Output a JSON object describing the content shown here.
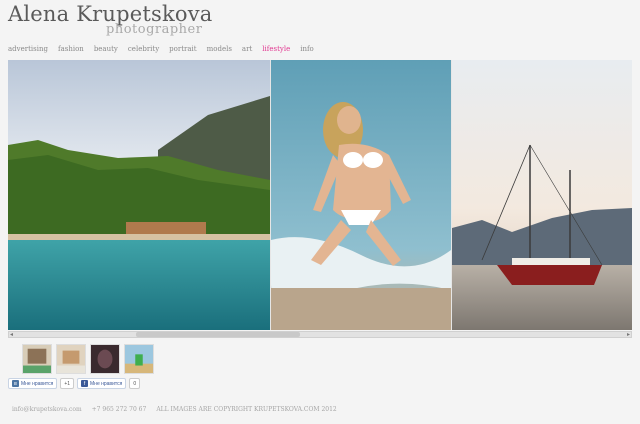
{
  "header": {
    "name": "Alena Krupetskova",
    "tagline": "photographer"
  },
  "nav": {
    "items": [
      {
        "label": "advertising"
      },
      {
        "label": "fashion"
      },
      {
        "label": "beauty"
      },
      {
        "label": "celebrity"
      },
      {
        "label": "portrait"
      },
      {
        "label": "models"
      },
      {
        "label": "art"
      },
      {
        "label": "lifestyle",
        "active": true
      },
      {
        "label": "info"
      }
    ],
    "active_color": "#e23a92"
  },
  "gallery": {
    "photos": [
      {
        "subject": "green-island-bay"
      },
      {
        "subject": "woman-in-white-bikini-in-surf"
      },
      {
        "subject": "sailing-ship-at-sunset"
      }
    ]
  },
  "thumbnails": [
    {
      "subject": "thumb-1"
    },
    {
      "subject": "thumb-2"
    },
    {
      "subject": "thumb-3"
    },
    {
      "subject": "thumb-4"
    }
  ],
  "social": {
    "vk_label": "Мне нравится",
    "vk_count": "+1",
    "fb_label": "Мне нравится",
    "fb_count": "0"
  },
  "footer": {
    "email": "info@krupetskova.com",
    "phone": "+7 965 272 70 67",
    "copyright": "ALL IMAGES ARE COPYRIGHT KRUPETSKOVA.COM 2012"
  }
}
